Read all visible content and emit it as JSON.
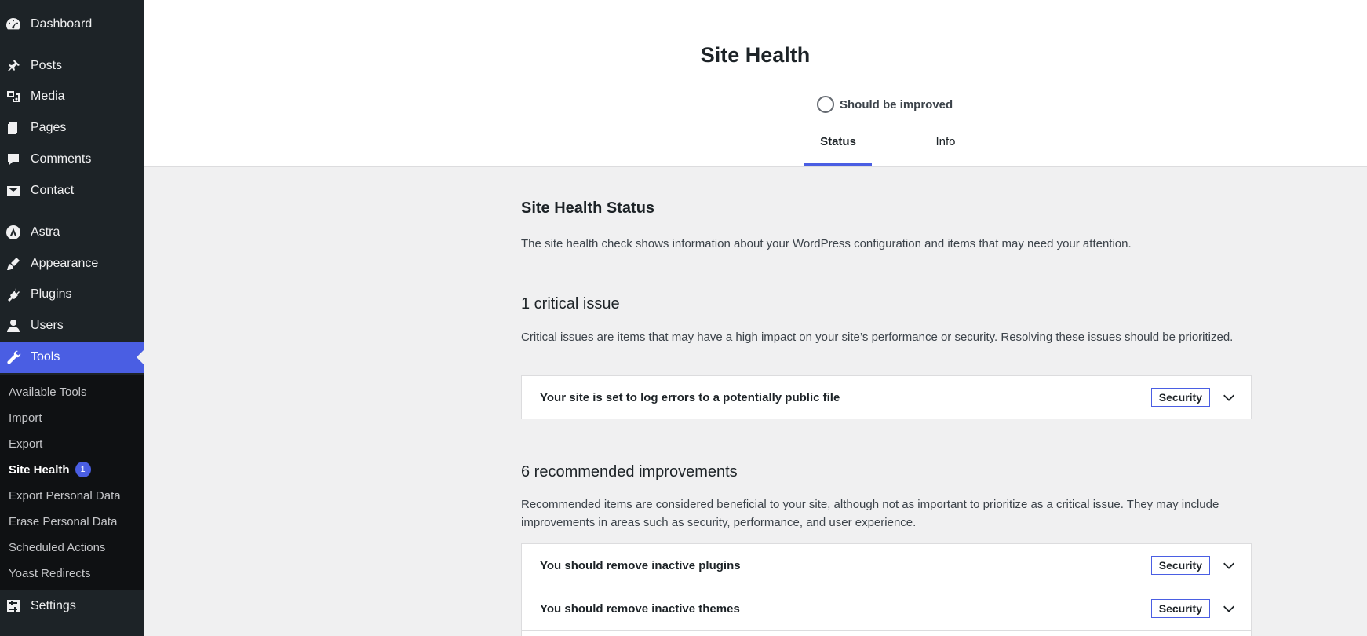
{
  "sidebar": {
    "menu": [
      {
        "label": "Dashboard",
        "icon": "dashboard-icon"
      },
      {
        "label": "Posts",
        "icon": "pin-icon"
      },
      {
        "label": "Media",
        "icon": "media-icon"
      },
      {
        "label": "Pages",
        "icon": "pages-icon"
      },
      {
        "label": "Comments",
        "icon": "comment-icon"
      },
      {
        "label": "Contact",
        "icon": "mail-icon"
      },
      {
        "label": "Astra",
        "icon": "astra-icon"
      },
      {
        "label": "Appearance",
        "icon": "brush-icon"
      },
      {
        "label": "Plugins",
        "icon": "plug-icon"
      },
      {
        "label": "Users",
        "icon": "user-icon"
      },
      {
        "label": "Tools",
        "icon": "wrench-icon"
      },
      {
        "label": "Settings",
        "icon": "settings-icon"
      }
    ],
    "submenu": [
      {
        "label": "Available Tools"
      },
      {
        "label": "Import"
      },
      {
        "label": "Export"
      },
      {
        "label": "Site Health",
        "badge": "1"
      },
      {
        "label": "Export Personal Data"
      },
      {
        "label": "Erase Personal Data"
      },
      {
        "label": "Scheduled Actions"
      },
      {
        "label": "Yoast Redirects"
      }
    ]
  },
  "header": {
    "title": "Site Health",
    "status": "Should be improved",
    "tabs": [
      {
        "label": "Status"
      },
      {
        "label": "Info"
      }
    ]
  },
  "main": {
    "heading": "Site Health Status",
    "description": "The site health check shows information about your WordPress configuration and items that may need your attention.",
    "critical": {
      "heading": "1 critical issue",
      "description": "Critical issues are items that may have a high impact on your site’s performance or security. Resolving these issues should be prioritized.",
      "items": [
        {
          "title": "Your site is set to log errors to a potentially public file",
          "badge": "Security"
        }
      ]
    },
    "recommended": {
      "heading": "6 recommended improvements",
      "description": "Recommended items are considered beneficial to your site, although not as important to prioritize as a critical issue. They may include improvements in areas such as security, performance, and user experience.",
      "items": [
        {
          "title": "You should remove inactive plugins",
          "badge": "Security"
        },
        {
          "title": "You should remove inactive themes",
          "badge": "Security"
        }
      ]
    }
  },
  "colors": {
    "accent": "#4a5ee3",
    "sidebar_bg": "#1d2327",
    "submenu_bg": "#0f1113",
    "page_bg": "#f0f0f1"
  }
}
